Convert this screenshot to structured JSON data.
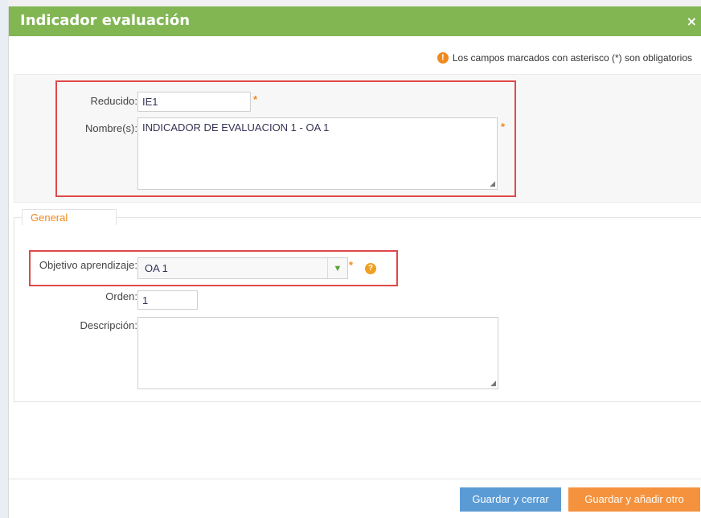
{
  "dialog": {
    "title": "Indicador evaluación",
    "close_label": "×"
  },
  "notice": {
    "icon": "warning-circle-icon",
    "text": "Los campos marcados con asterisco (*) son obligatorios"
  },
  "top_fields": {
    "reducido": {
      "label": "Reducido:",
      "value": "IE1",
      "required_mark": "*"
    },
    "nombres": {
      "label": "Nombre(s):",
      "value": "INDICADOR DE EVALUACION 1 - OA 1",
      "required_mark": "*"
    }
  },
  "general": {
    "legend": "General",
    "objetivo": {
      "label": "Objetivo aprendizaje:",
      "value": "OA 1",
      "required_mark": "*",
      "help": "?"
    },
    "orden": {
      "label": "Orden:",
      "value": "1"
    },
    "descripcion": {
      "label": "Descripción:",
      "value": ""
    }
  },
  "buttons": {
    "save_close": "Guardar y cerrar",
    "save_add": "Guardar y añadir otro"
  },
  "colors": {
    "titlebar": "#82b653",
    "accent_orange": "#f08a1c",
    "button_blue": "#5b9bd5",
    "button_orange": "#f5923e",
    "highlight_red": "#e04848"
  }
}
